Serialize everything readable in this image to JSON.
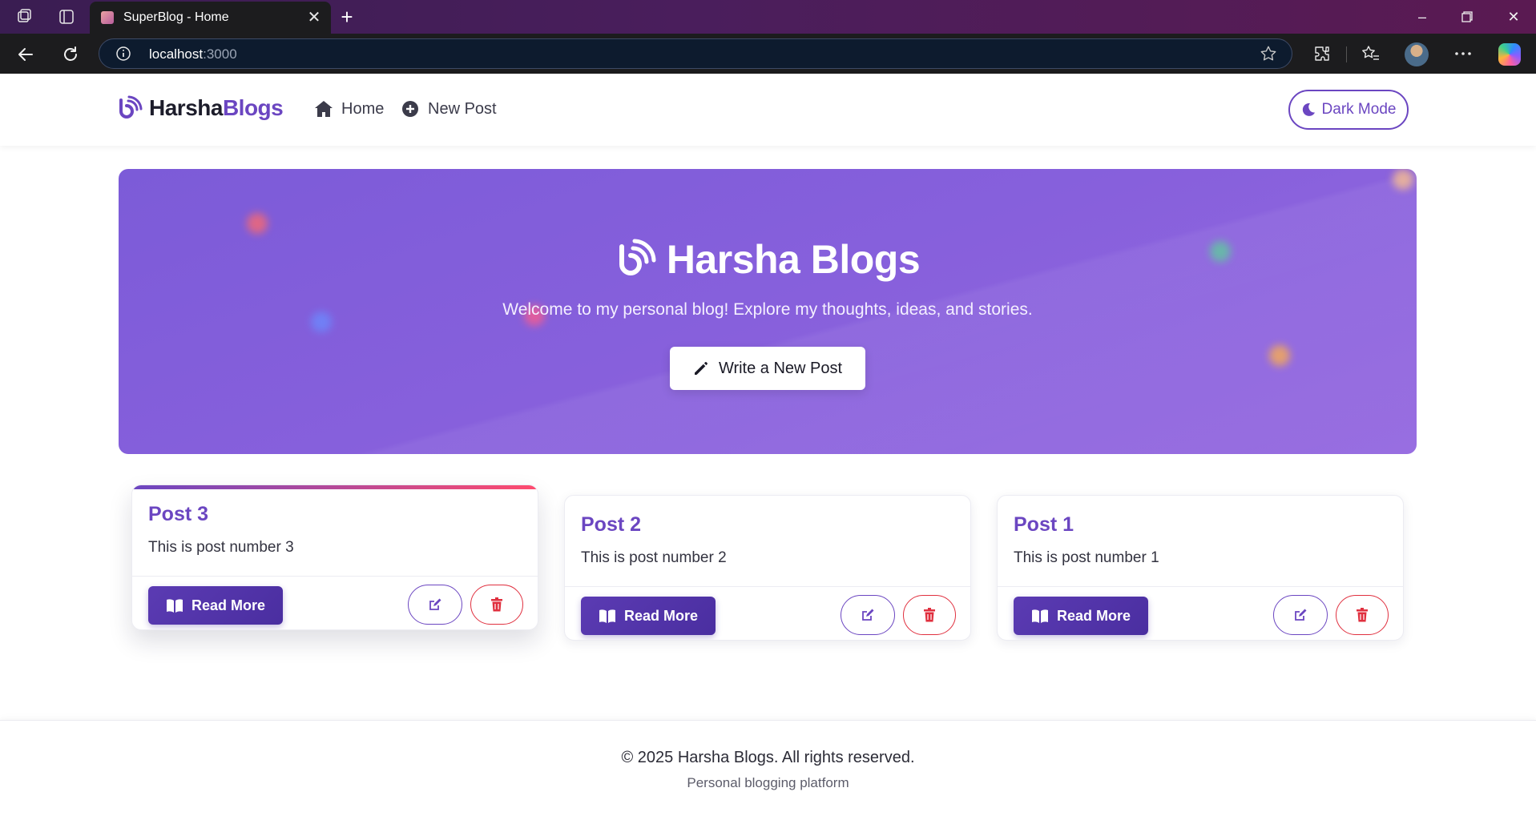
{
  "browser": {
    "tab_title": "SuperBlog - Home",
    "url_host": "localhost",
    "url_port": ":3000",
    "icons": [
      "workspaces-icon",
      "tab-actions-icon",
      "close-icon",
      "new-tab-icon",
      "minimize-icon",
      "restore-icon",
      "window-close-icon",
      "back-icon",
      "refresh-icon",
      "info-icon",
      "favorite-star-icon",
      "extensions-icon",
      "favorites-icon",
      "profile-avatar",
      "more-icon",
      "copilot-icon"
    ]
  },
  "navbar": {
    "brand_main": "Harsha",
    "brand_accent": "Blogs",
    "links": [
      {
        "label": "Home",
        "icon": "home-icon"
      },
      {
        "label": "New Post",
        "icon": "plus-circle-icon"
      }
    ],
    "theme_toggle_label": "Dark Mode",
    "theme_toggle_icon": "moon-icon"
  },
  "hero": {
    "title": "Harsha Blogs",
    "subtitle": "Welcome to my personal blog! Explore my thoughts, ideas, and stories.",
    "cta_label": "Write a New Post",
    "cta_icon": "pencil-icon",
    "background_color": "#8760dc"
  },
  "posts": [
    {
      "title": "Post 3",
      "excerpt": "This is post number 3",
      "read_more_label": "Read More"
    },
    {
      "title": "Post 2",
      "excerpt": "This is post number 2",
      "read_more_label": "Read More"
    },
    {
      "title": "Post 1",
      "excerpt": "This is post number 1",
      "read_more_label": "Read More"
    }
  ],
  "footer": {
    "copyright": "© 2025 Harsha Blogs. All rights reserved.",
    "tagline": "Personal blogging platform"
  },
  "colors": {
    "accent": "#6b46c1",
    "danger": "#e0303f",
    "tabbar": "#4a1e5c"
  }
}
